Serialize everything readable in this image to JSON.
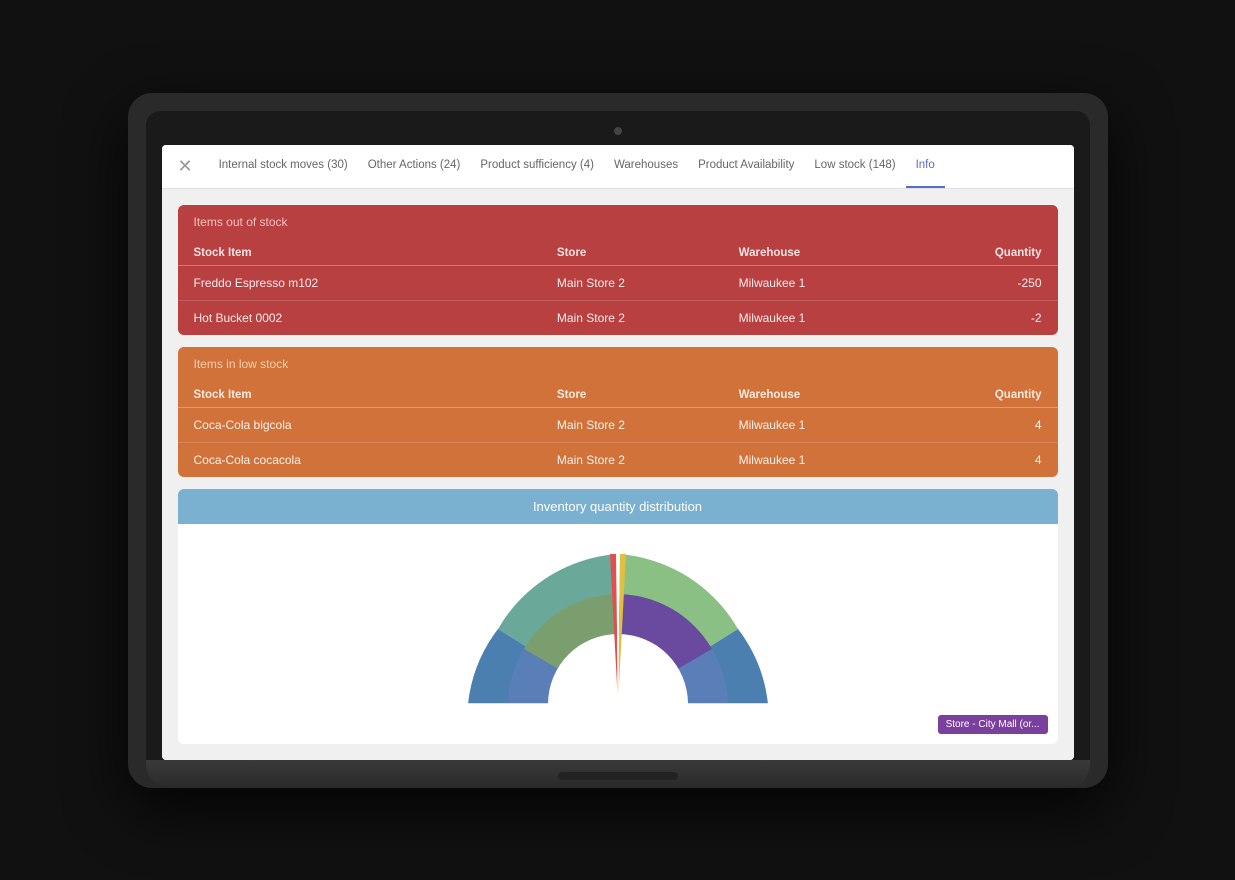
{
  "nav": {
    "close_icon": "×",
    "items": [
      {
        "label": "Internal stock moves (30)",
        "active": false
      },
      {
        "label": "Other Actions (24)",
        "active": false
      },
      {
        "label": "Product sufficiency (4)",
        "active": false
      },
      {
        "label": "Warehouses",
        "active": false
      },
      {
        "label": "Product Availability",
        "active": false
      },
      {
        "label": "Low stock (148)",
        "active": false
      },
      {
        "label": "Info",
        "active": true
      }
    ]
  },
  "out_of_stock": {
    "section_label": "Items out of stock",
    "columns": [
      "Stock Item",
      "Store",
      "Warehouse",
      "Quantity"
    ],
    "rows": [
      {
        "stock_item": "Freddo Espresso m102",
        "store": "Main Store 2",
        "warehouse": "Milwaukee 1",
        "quantity": "-250"
      },
      {
        "stock_item": "Hot Bucket 0002",
        "store": "Main Store 2",
        "warehouse": "Milwaukee 1",
        "quantity": "-2"
      }
    ]
  },
  "low_stock": {
    "section_label": "Items in low stock",
    "columns": [
      "Stock Item",
      "Store",
      "Warehouse",
      "Quantity"
    ],
    "rows": [
      {
        "stock_item": "Coca-Cola bigcola",
        "store": "Main Store 2",
        "warehouse": "Milwaukee 1",
        "quantity": "4"
      },
      {
        "stock_item": "Coca-Cola cocacola",
        "store": "Main Store 2",
        "warehouse": "Milwaukee 1",
        "quantity": "4"
      }
    ]
  },
  "chart": {
    "title": "Inventory quantity distribution",
    "tooltip": "Store - City Mall (or..."
  },
  "colors": {
    "out_of_stock_bg": "#b94040",
    "low_stock_bg": "#d0723a",
    "chart_header_bg": "#7ab0d0",
    "nav_active": "#5b6bbf"
  }
}
